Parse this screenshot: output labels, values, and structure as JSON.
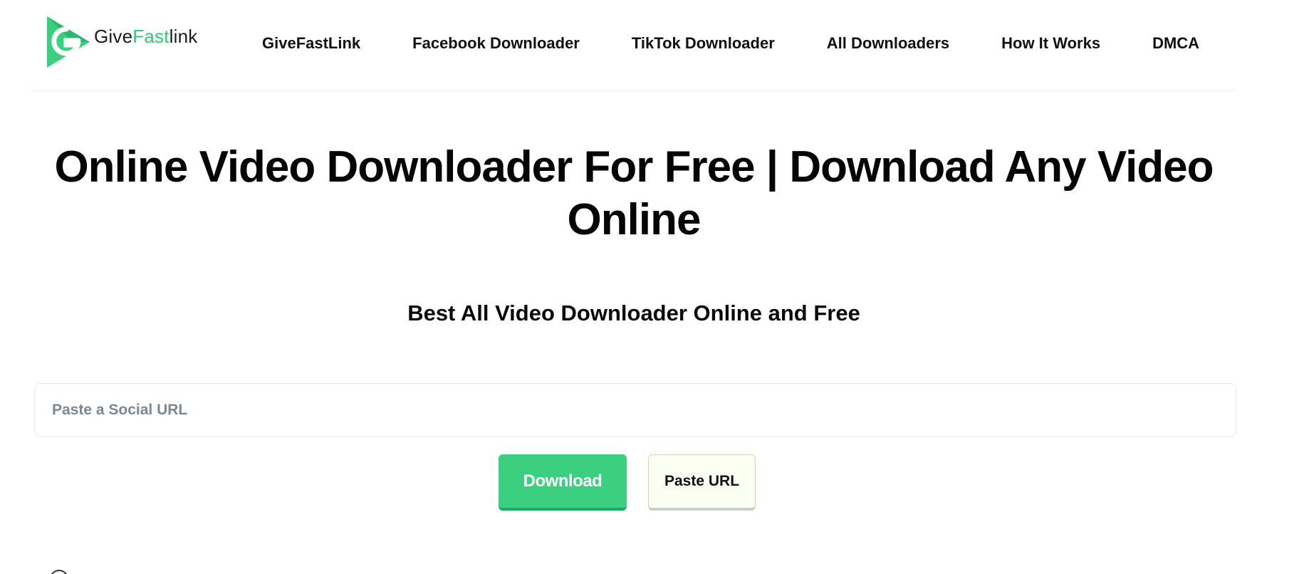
{
  "brand": {
    "name_part1": "Give",
    "name_part2": "Fast",
    "name_part3": "link",
    "icon": "g-play-logo-icon",
    "accent_color": "#3ad07f"
  },
  "nav": {
    "items": [
      {
        "label": "GiveFastLink"
      },
      {
        "label": "Facebook Downloader"
      },
      {
        "label": "TikTok Downloader"
      },
      {
        "label": "All Downloaders"
      },
      {
        "label": "How It Works"
      },
      {
        "label": "DMCA"
      }
    ]
  },
  "hero": {
    "title": "Online Video Downloader For Free | Download Any Video Online",
    "subtitle": "Best All Video Downloader Online and Free"
  },
  "form": {
    "url_placeholder": "Paste a Social URL",
    "url_value": "",
    "download_label": "Download",
    "paste_label": "Paste URL"
  }
}
